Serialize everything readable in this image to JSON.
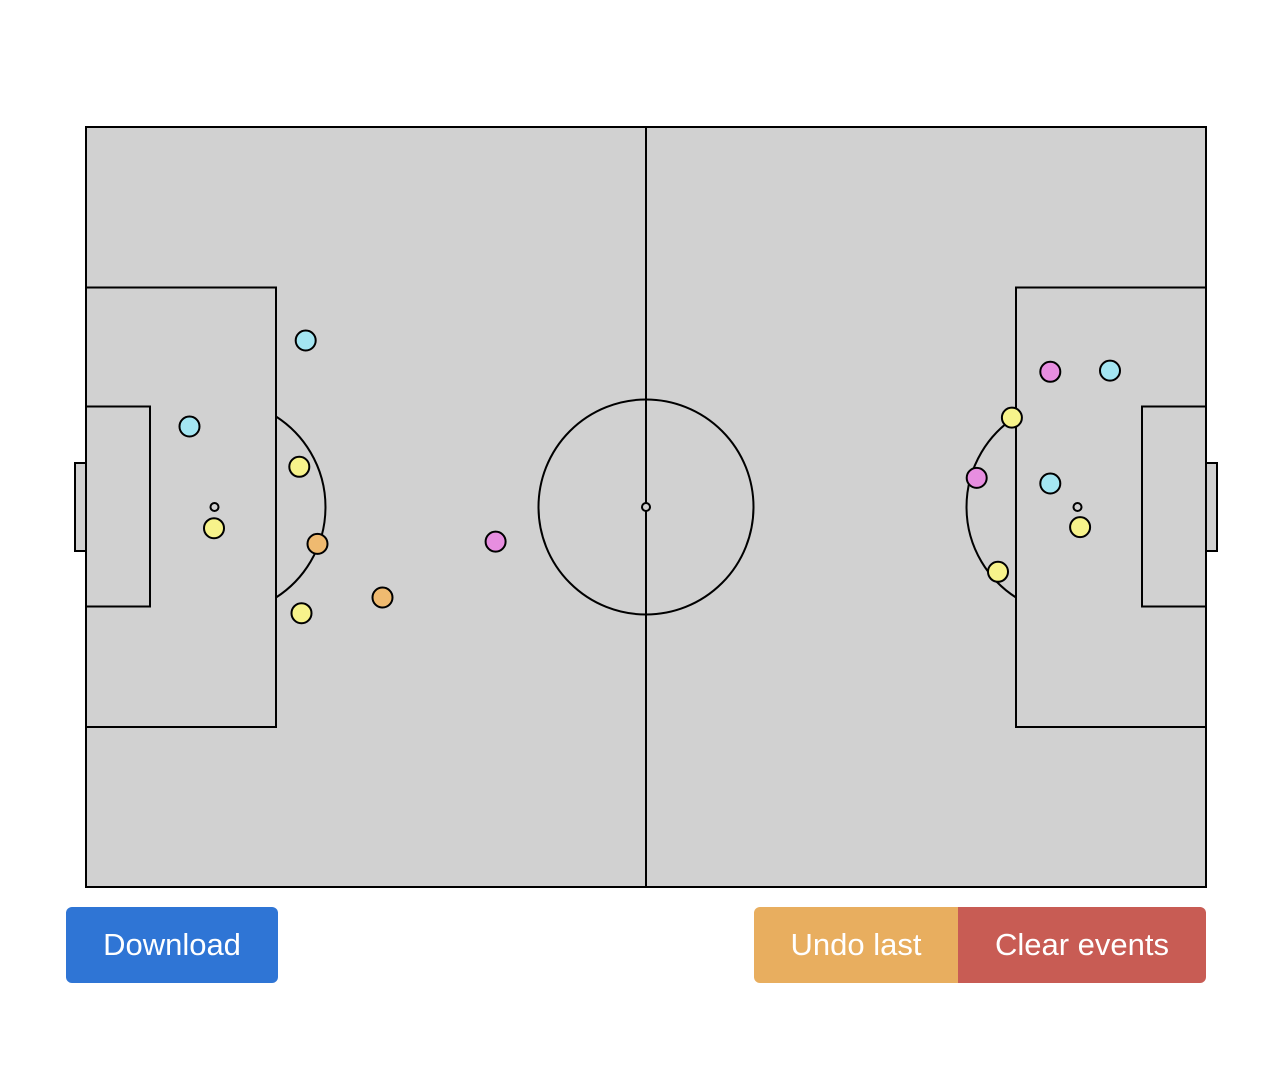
{
  "pitch": {
    "fill": "#d1d1d1",
    "line_color": "#000000",
    "length_m": 105,
    "width_m": 68
  },
  "event_colors": {
    "yellow": "#f7f38b",
    "cyan": "#a4e6f2",
    "orange": "#efba70",
    "pink": "#e78ee0"
  },
  "events": [
    {
      "x": 20.6,
      "y": 19.1,
      "color": "cyan"
    },
    {
      "x": 9.7,
      "y": 26.8,
      "color": "cyan"
    },
    {
      "x": 20.0,
      "y": 30.4,
      "color": "yellow"
    },
    {
      "x": 12.0,
      "y": 35.9,
      "color": "yellow"
    },
    {
      "x": 21.7,
      "y": 37.3,
      "color": "orange"
    },
    {
      "x": 20.2,
      "y": 43.5,
      "color": "yellow"
    },
    {
      "x": 27.8,
      "y": 42.1,
      "color": "orange"
    },
    {
      "x": 38.4,
      "y": 37.1,
      "color": "pink"
    },
    {
      "x": 90.4,
      "y": 21.9,
      "color": "pink"
    },
    {
      "x": 96.0,
      "y": 21.8,
      "color": "cyan"
    },
    {
      "x": 86.8,
      "y": 26.0,
      "color": "yellow"
    },
    {
      "x": 83.5,
      "y": 31.4,
      "color": "pink"
    },
    {
      "x": 90.4,
      "y": 31.9,
      "color": "cyan"
    },
    {
      "x": 93.2,
      "y": 35.8,
      "color": "yellow"
    },
    {
      "x": 85.5,
      "y": 39.8,
      "color": "yellow"
    }
  ],
  "buttons": {
    "download": {
      "label": "Download",
      "color": "#2f75d5"
    },
    "undo": {
      "label": "Undo last",
      "color": "#e8ae5f"
    },
    "clear": {
      "label": "Clear events",
      "color": "#c85c54"
    }
  }
}
